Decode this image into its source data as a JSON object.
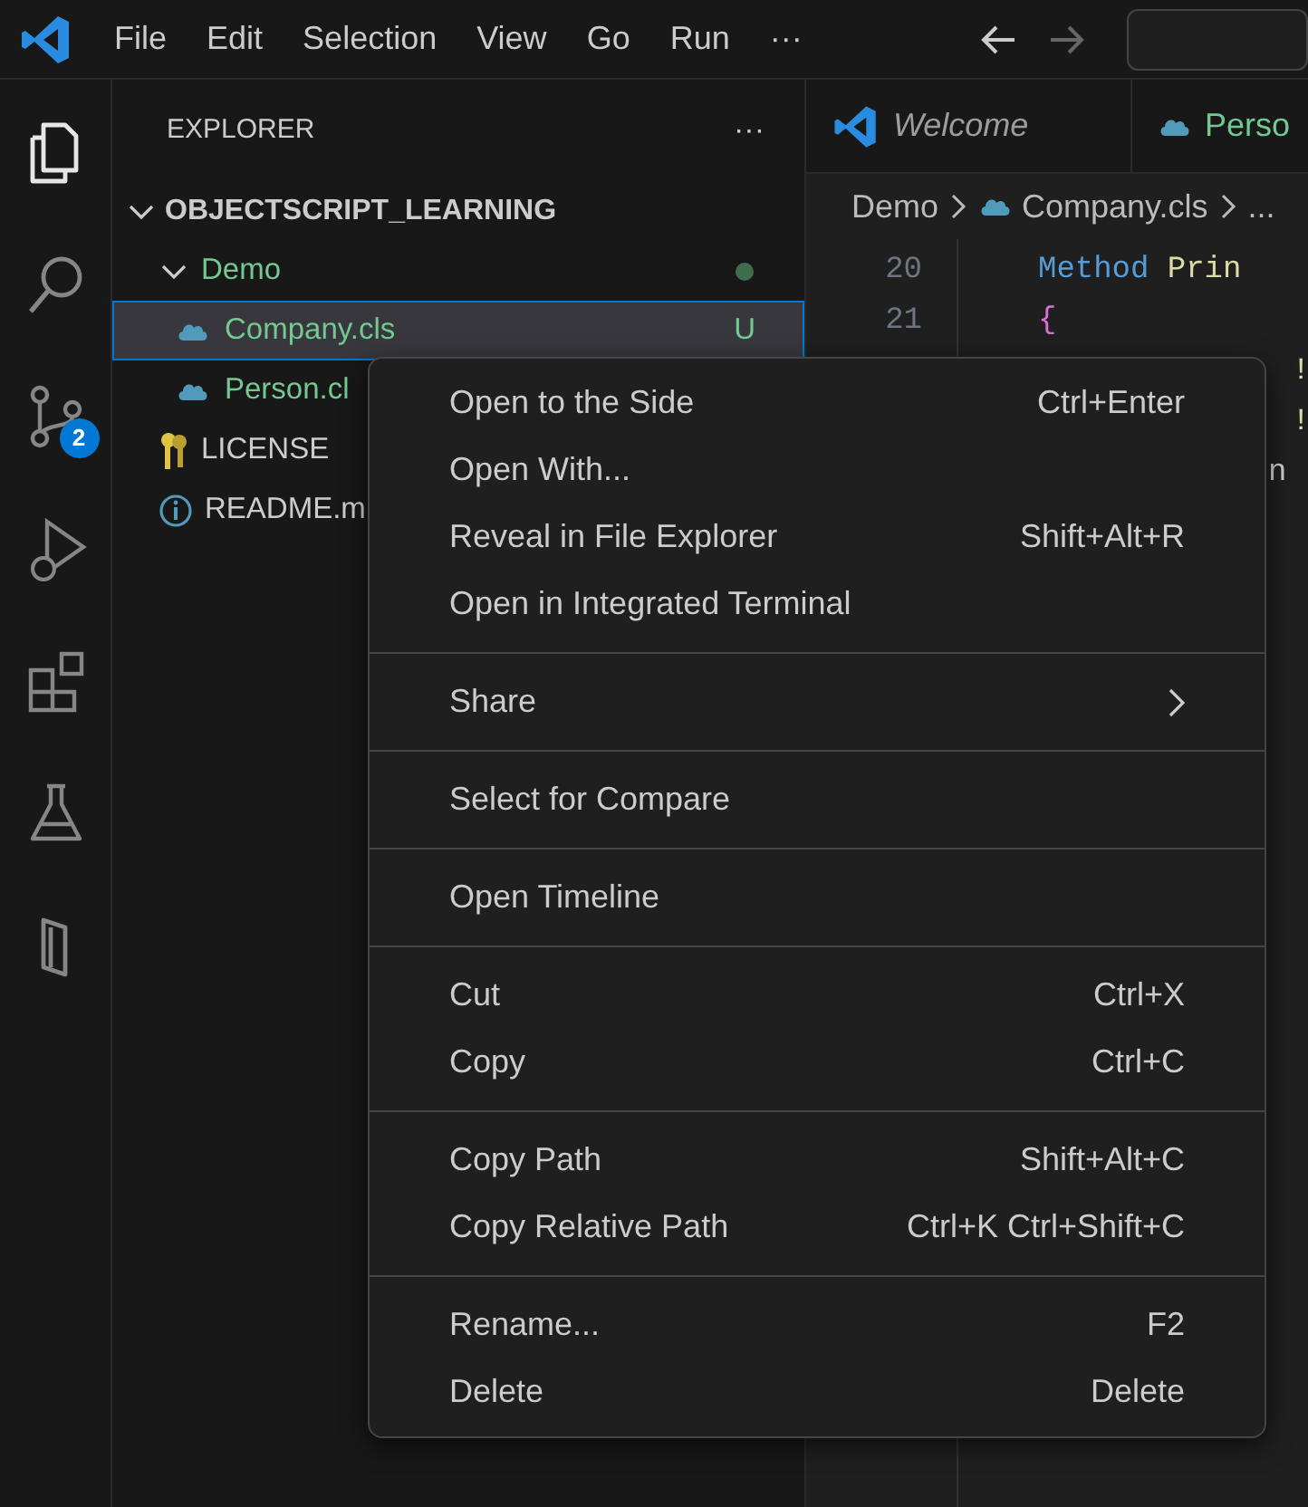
{
  "title_bar": {
    "menus": [
      "File",
      "Edit",
      "Selection",
      "View",
      "Go",
      "Run"
    ],
    "more": "···",
    "back_disabled": false,
    "forward_disabled": true
  },
  "activity_bar": [
    {
      "kind": "files",
      "selected": true
    },
    {
      "kind": "search",
      "selected": false
    },
    {
      "kind": "source-control",
      "selected": false,
      "badge": "2"
    },
    {
      "kind": "run",
      "selected": false
    },
    {
      "kind": "extensions",
      "selected": false
    },
    {
      "kind": "flask",
      "selected": false
    },
    {
      "kind": "bookmark",
      "selected": false
    }
  ],
  "sidebar": {
    "title": "EXPLORER",
    "more": "···",
    "root": {
      "label": "OBJECTSCRIPT_LEARNING",
      "expanded": true,
      "children": [
        {
          "label": "Demo",
          "kind": "folder",
          "expanded": true,
          "untracked": true,
          "children": [
            {
              "label": "Company.cls",
              "kind": "cls",
              "untracked": true,
              "selected": true,
              "git": "U"
            },
            {
              "label": "Person.cl",
              "kind": "cls",
              "untracked": true,
              "selected": false
            }
          ]
        },
        {
          "label": "LICENSE",
          "kind": "license",
          "untracked": false,
          "selected": false
        },
        {
          "label": "README.m",
          "kind": "info",
          "untracked": false,
          "selected": false
        }
      ]
    }
  },
  "editor": {
    "tabs": [
      {
        "label": "Welcome",
        "kind": "welcome",
        "selected": false
      },
      {
        "label": "Perso",
        "kind": "cls",
        "selected": false
      }
    ],
    "breadcrumb": [
      "Demo",
      "Company.cls",
      "..."
    ],
    "lines": [
      {
        "number": "20",
        "tokens": [
          {
            "text": "Method",
            "kind": "keyword"
          },
          {
            "text": "Prin",
            "kind": "name"
          }
        ]
      },
      {
        "number": "21",
        "tokens": [
          {
            "text": "{",
            "kind": "brace"
          }
        ]
      },
      {
        "tokens": [
          {
            "text": "!",
            "kind": "name"
          }
        ]
      },
      {
        "tokens": [
          {
            "text": "!",
            "kind": "name"
          }
        ]
      },
      {
        "tokens": [
          {
            "text": "n",
            "kind": "plain"
          }
        ]
      }
    ]
  },
  "context_menu": {
    "groups": [
      [
        {
          "label": "Open to the Side",
          "shortcut": "Ctrl+Enter"
        },
        {
          "label": "Open With..."
        },
        {
          "label": "Reveal in File Explorer",
          "shortcut": "Shift+Alt+R"
        },
        {
          "label": "Open in Integrated Terminal"
        }
      ],
      [
        {
          "label": "Share",
          "submenu": true
        }
      ],
      [
        {
          "label": "Select for Compare"
        }
      ],
      [
        {
          "label": "Open Timeline"
        }
      ],
      [
        {
          "label": "Cut",
          "shortcut": "Ctrl+X"
        },
        {
          "label": "Copy",
          "shortcut": "Ctrl+C"
        }
      ],
      [
        {
          "label": "Copy Path",
          "shortcut": "Shift+Alt+C"
        },
        {
          "label": "Copy Relative Path",
          "shortcut": "Ctrl+K Ctrl+Shift+C"
        }
      ],
      [
        {
          "label": "Rename...",
          "shortcut": "F2"
        },
        {
          "label": "Delete",
          "shortcut": "Delete"
        }
      ]
    ]
  }
}
